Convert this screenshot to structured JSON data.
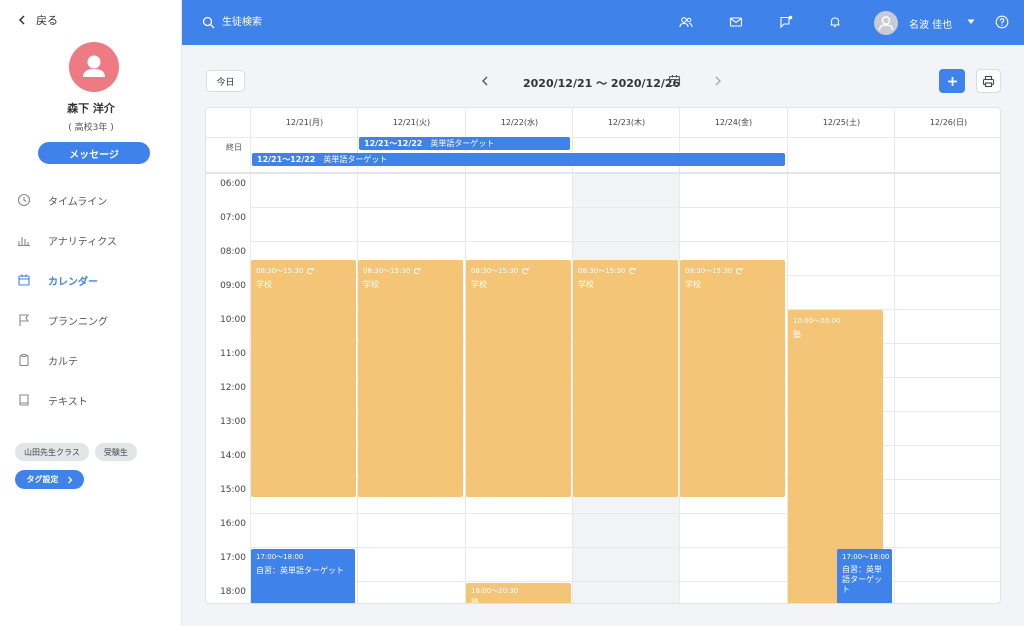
{
  "sidebar": {
    "back_label": "戻る",
    "student_name": "森下 洋介",
    "student_grade": "( 高校3年 )",
    "message_button": "メッセージ",
    "nav": [
      {
        "label": "タイムライン",
        "icon": "clock-icon",
        "active": false
      },
      {
        "label": "アナリティクス",
        "icon": "bar-chart-icon",
        "active": false
      },
      {
        "label": "カレンダー",
        "icon": "calendar-icon",
        "active": true
      },
      {
        "label": "プランニング",
        "icon": "flag-icon",
        "active": false
      },
      {
        "label": "カルテ",
        "icon": "clipboard-icon",
        "active": false
      },
      {
        "label": "テキスト",
        "icon": "book-icon",
        "active": false
      }
    ],
    "tags": [
      "山田先生クラス",
      "受験生"
    ],
    "tag_settings_button": "タグ設定"
  },
  "topbar": {
    "search_placeholder": "生徒検索",
    "user_name": "名波 佳也"
  },
  "calendar": {
    "today_button": "今日",
    "range_label": "2020/12/21 〜 2020/12/26",
    "all_day_label": "終日",
    "days": [
      "12/21(月)",
      "12/21(火)",
      "12/22(水)",
      "12/23(木)",
      "12/24(金)",
      "12/25(土)",
      "12/26(日)"
    ],
    "hours": [
      "06:00",
      "07:00",
      "08:00",
      "09:00",
      "10:00",
      "11:00",
      "12:00",
      "13:00",
      "14:00",
      "15:00",
      "16:00",
      "17:00",
      "18:00"
    ],
    "all_day_events": [
      {
        "time": "12/21〜12/22",
        "title": "英単語ターゲット"
      },
      {
        "time": "12/21〜12/22",
        "title": "英単語ターゲット"
      }
    ],
    "events": [
      {
        "time": "08:30〜15:30",
        "title": "学校",
        "recurring": true
      },
      {
        "time": "08:30〜15:30",
        "title": "学校",
        "recurring": true
      },
      {
        "time": "08:30〜15:30",
        "title": "学校",
        "recurring": true
      },
      {
        "time": "08:30〜15:30",
        "title": "学校",
        "recurring": true
      },
      {
        "time": "08:30〜15:30",
        "title": "学校",
        "recurring": true
      },
      {
        "time": "10:00〜20:00",
        "title": "塾",
        "recurring": false
      },
      {
        "time": "17:00〜18:00",
        "title": "自習：英単語ターゲット",
        "recurring": false
      },
      {
        "time": "17:00〜18:00",
        "title": "自習：英単語ターゲット",
        "recurring": false
      },
      {
        "time": "18:00〜20:30",
        "title": "塾",
        "recurring": false
      }
    ],
    "colors": {
      "accent": "#3e82ea",
      "school": "#f4c576",
      "avatar": "#ee7a84"
    }
  }
}
